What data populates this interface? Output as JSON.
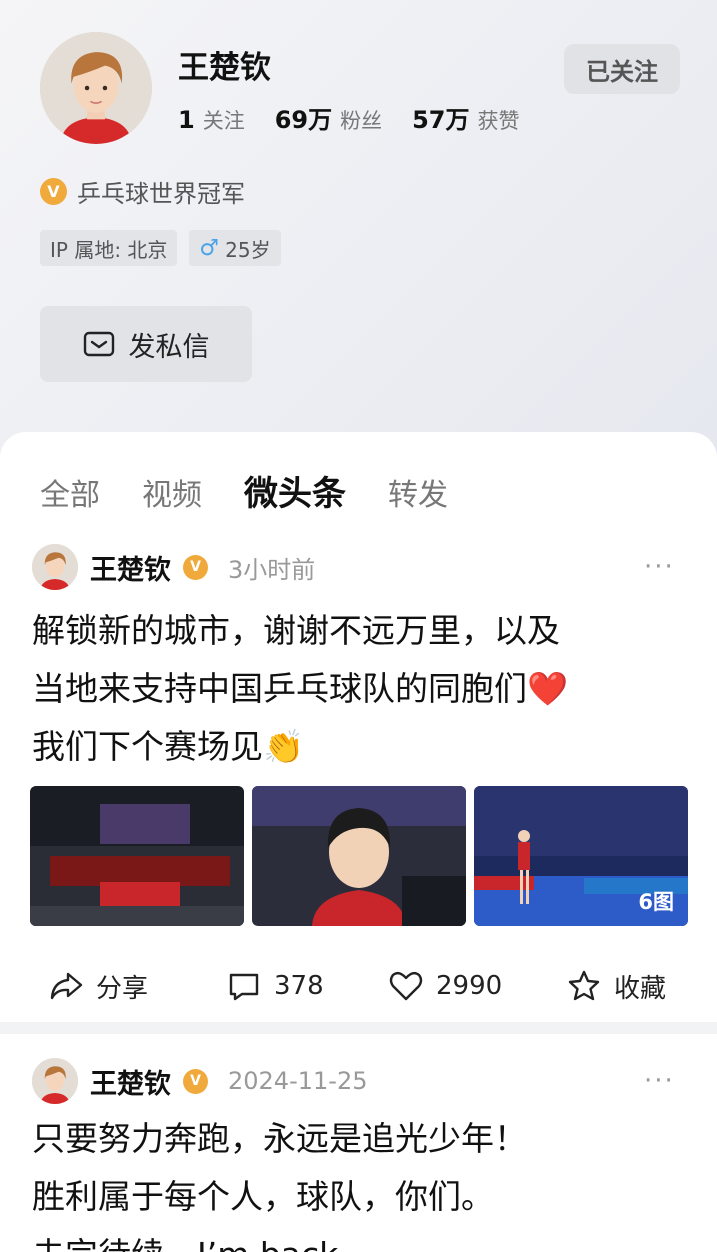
{
  "profile": {
    "name": "王楚钦",
    "follow_button": "已关注",
    "stats": [
      {
        "num": "1",
        "label": "关注"
      },
      {
        "num": "69万",
        "label": "粉丝"
      },
      {
        "num": "57万",
        "label": "获赞"
      }
    ],
    "verified_badge": "V",
    "verified_text": "乒乓球世界冠军",
    "ip_tag": "IP 属地: 北京",
    "gender_icon": "♂",
    "age_tag": "25岁",
    "dm_button": "发私信"
  },
  "tabs": [
    {
      "label": "全部",
      "active": false
    },
    {
      "label": "视频",
      "active": false
    },
    {
      "label": "微头条",
      "active": true
    },
    {
      "label": "转发",
      "active": false
    }
  ],
  "posts": [
    {
      "author": "王楚钦",
      "badge": "V",
      "time": "3小时前",
      "more": "···",
      "lines": [
        "解锁新的城市，谢谢不远万里，以及",
        "当地来支持中国乒乓球队的同胞们",
        "我们下个赛场见"
      ],
      "heart_emoji": "❤️",
      "clap_emoji": "👏",
      "photo_count": "6图",
      "actions": {
        "share": "分享",
        "comments": "378",
        "likes": "2990",
        "favorite": "收藏"
      }
    },
    {
      "author": "王楚钦",
      "badge": "V",
      "time": "2024-11-25",
      "more": "···",
      "lines": [
        "只要努力奔跑，永远是追光少年！",
        "胜利属于每个人，球队，你们。",
        "未完待续，I’m back"
      ]
    }
  ],
  "colors": {
    "badge": "#f0a93b",
    "accent_red": "#e0282e",
    "male_blue": "#4aa3e8"
  }
}
